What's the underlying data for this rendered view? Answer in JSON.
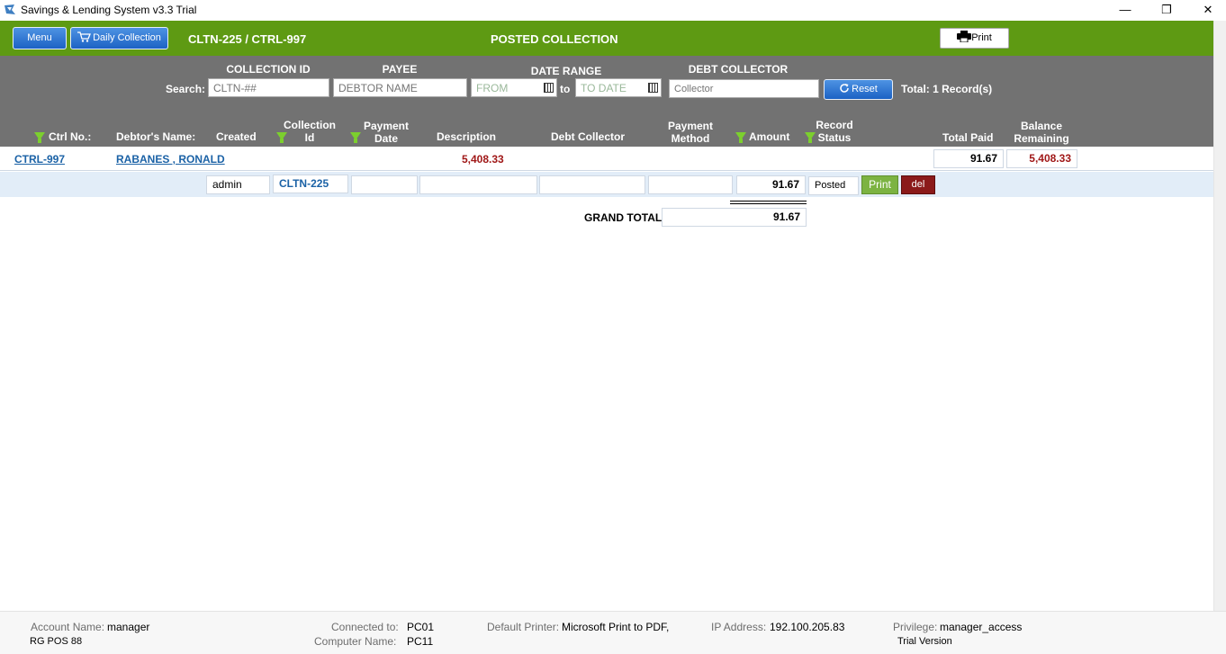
{
  "window": {
    "title": "Savings & Lending System v3.3 Trial",
    "minimize": "—",
    "restore": "❐",
    "close": "✕"
  },
  "toolbar": {
    "menu_label": "Menu",
    "daily_collection_label": "Daily Collection",
    "doc_code": "CLTN-225 / CTRL-997",
    "heading": "POSTED COLLECTION",
    "print_label": "Print"
  },
  "filters": {
    "search_label": "Search:",
    "collection_id_label": "COLLECTION ID",
    "collection_id_placeholder": "CLTN-##",
    "payee_label": "PAYEE",
    "payee_placeholder": "DEBTOR NAME",
    "date_range_label": "DATE RANGE",
    "from_placeholder": "FROM",
    "to_label": "to",
    "to_placeholder": "TO DATE",
    "debt_collector_label": "DEBT COLLECTOR",
    "collector_placeholder": "Collector",
    "reset_label": "Reset",
    "total_records": "Total: 1 Record(s)"
  },
  "columns": {
    "ctrl_no": "Ctrl No.:",
    "debtor_name": "Debtor's Name:",
    "created": "Created",
    "collection_id": "Collection Id",
    "payment_date": "Payment Date",
    "description": "Description",
    "debt_collector": "Debt Collector",
    "payment_method": "Payment Method",
    "amount": "Amount",
    "record_status": "Record Status",
    "total_paid": "Total Paid",
    "balance_remaining": "Balance Remaining"
  },
  "record": {
    "ctrl_no": "CTRL-997",
    "debtor_name": "RABANES , RONALD",
    "description": "5,408.33",
    "total_paid": "91.67",
    "balance_remaining": "5,408.33"
  },
  "detail": {
    "created": "admin",
    "collection_id": "CLTN-225",
    "payment_date": "",
    "description": "",
    "debt_collector": "",
    "payment_method": "",
    "amount": "91.67",
    "status": "Posted",
    "print_label": "Print",
    "del_label": "del"
  },
  "grand_total": {
    "label": "GRAND TOTAL:",
    "value": "91.67"
  },
  "footer": {
    "account_name_label": "Account Name:",
    "account_name": "manager",
    "pos_name": "RG POS 88",
    "connected_to_label": "Connected to:",
    "connected_to": "PC01",
    "computer_name_label": "Computer Name:",
    "computer_name": "PC11",
    "default_printer_label": "Default Printer:",
    "default_printer": "Microsoft Print to PDF,",
    "ip_address_label": "IP Address:",
    "ip_address": "192.100.205.83",
    "privilege_label": "Privilege:",
    "privilege": "manager_access",
    "version": "Trial Version"
  },
  "colors": {
    "toolbar_green": "#5e9a13",
    "band_grey": "#727272",
    "link_blue": "#1b62a6",
    "balance_red": "#a01818",
    "button_blue": "#1c62c4",
    "del_red": "#8b1a1a"
  }
}
